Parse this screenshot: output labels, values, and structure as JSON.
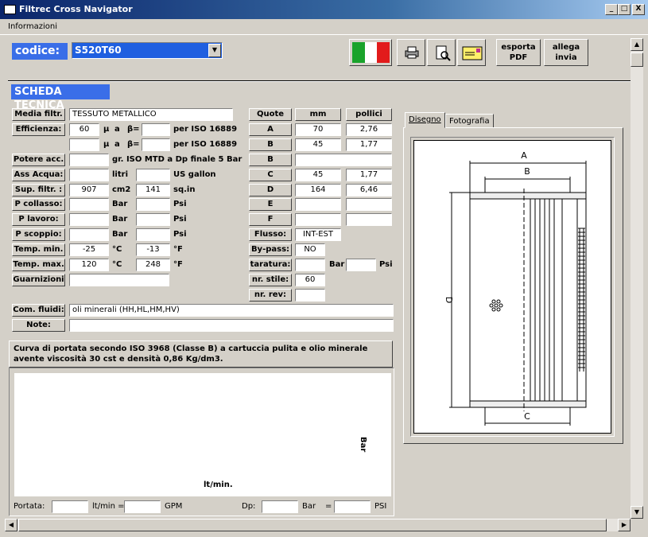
{
  "window": {
    "title": "Filtrec Cross Navigator",
    "min": "_",
    "max": "□",
    "close": "X"
  },
  "menu": {
    "informazioni": "Informazioni"
  },
  "header": {
    "codice_label": "codice:",
    "codice_value": "S520T60",
    "esporta": "esporta",
    "esporta2": "PDF",
    "allega": "allega",
    "allega2": "invia"
  },
  "section_title": "SCHEDA TECNICA",
  "left": {
    "media_label": "Media filtr.",
    "media_value": "TESSUTO METALLICO",
    "efficienza_label": "Efficienza:",
    "eff1_val": "60",
    "mu": "µ",
    "a": "a",
    "beta": "β=",
    "iso": "per ISO 16889",
    "potere_label": "Potere acc.",
    "potere_text": "gr. ISO MTD a Dp finale 5 Bar",
    "ass_label": "Ass Acqua:",
    "litri": "litri",
    "usgallon": "US gallon",
    "sup_label": "Sup. filtr. :",
    "sup_val": "907",
    "cm2": "cm2",
    "sup_val2": "141",
    "sqin": "sq.in",
    "pcollasso_label": "P collasso:",
    "plavoro_label": "P lavoro:",
    "pscoppio_label": "P scoppio:",
    "bar": "Bar",
    "psi": "Psi",
    "tmin_label": "Temp. min.",
    "tmin_c": "-25",
    "tmin_f": "-13",
    "tmax_label": "Temp. max.",
    "tmax_c": "120",
    "tmax_f": "248",
    "degc": "°C",
    "degf": "°F",
    "guarnizioni_label": "Guarnizioni",
    "com_label": "Com. fluidi:",
    "com_value": "oli minerali (HH,HL,HM,HV)",
    "note_label": "Note:"
  },
  "quote": {
    "quote_label": "Quote",
    "mm_label": "mm",
    "pollici_label": "pollici",
    "rows": [
      {
        "label": "A",
        "mm": "70",
        "in": "2,76"
      },
      {
        "label": "B",
        "mm": "45",
        "in": "1,77"
      },
      {
        "label": "B",
        "mm": "",
        "in": ""
      },
      {
        "label": "C",
        "mm": "45",
        "in": "1,77"
      },
      {
        "label": "D",
        "mm": "164",
        "in": "6,46"
      },
      {
        "label": "E",
        "mm": "",
        "in": ""
      },
      {
        "label": "F",
        "mm": "",
        "in": ""
      }
    ],
    "flusso_label": "Flusso:",
    "flusso_val": "INT-EST",
    "bypass_label": "By-pass:",
    "bypass_val": "NO",
    "taratura_label": "taratura:",
    "bar": "Bar",
    "psi": "Psi",
    "stile_label": "nr. stile:",
    "stile_val": "60",
    "rev_label": "nr. rev:"
  },
  "tabs": {
    "disegno": "Disegno",
    "fotografia": "Fotografia"
  },
  "drawing": {
    "A": "A",
    "B": "B",
    "C": "C",
    "D": "D"
  },
  "curve": {
    "title": "Curva di portata secondo ISO 3968 (Classe B) a cartuccia pulita e olio minerale avente viscosità 30 cst e densità 0,86 Kg/dm3.",
    "ylabel": "Bar",
    "xlabel": "lt/min.",
    "portata_label": "Portata:",
    "ltmin_eq": "lt/min =",
    "gpm": "GPM",
    "dp_label": "Dp:",
    "bar_eq": "Bar",
    "eq": "=",
    "psi": "PSI"
  },
  "colors": {
    "accent": "#3a6ee8",
    "title": "#0a246a",
    "combo": "#1f5fe0"
  }
}
